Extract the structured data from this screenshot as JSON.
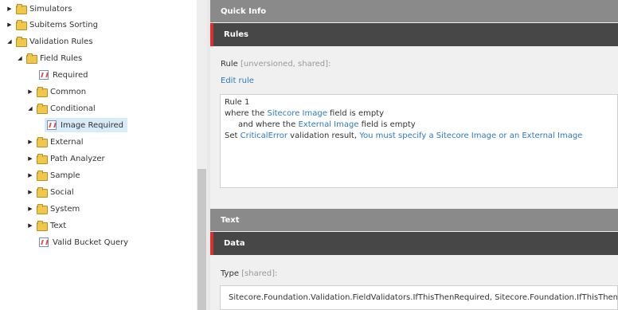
{
  "tree": {
    "items": [
      {
        "label": "Simulators",
        "type": "folder",
        "arrow": "collapsed"
      },
      {
        "label": "Subitems Sorting",
        "type": "folder",
        "arrow": "collapsed"
      },
      {
        "label": "Validation Rules",
        "type": "folder",
        "arrow": "expanded"
      },
      {
        "label": "Field Rules",
        "type": "folder",
        "arrow": "expanded"
      },
      {
        "label": "Required",
        "type": "item",
        "arrow": "none"
      },
      {
        "label": "Common",
        "type": "folder",
        "arrow": "collapsed"
      },
      {
        "label": "Conditional",
        "type": "folder",
        "arrow": "expanded"
      },
      {
        "label": "Image Required",
        "type": "item",
        "arrow": "none",
        "selected": true
      },
      {
        "label": "External",
        "type": "folder",
        "arrow": "collapsed"
      },
      {
        "label": "Path Analyzer",
        "type": "folder",
        "arrow": "collapsed"
      },
      {
        "label": "Sample",
        "type": "folder",
        "arrow": "collapsed"
      },
      {
        "label": "Social",
        "type": "folder",
        "arrow": "collapsed"
      },
      {
        "label": "System",
        "type": "folder",
        "arrow": "collapsed"
      },
      {
        "label": "Text",
        "type": "folder",
        "arrow": "collapsed"
      },
      {
        "label": "Valid Bucket Query",
        "type": "item",
        "arrow": "none"
      }
    ]
  },
  "sections": {
    "quick_info": "Quick Info",
    "rules": "Rules",
    "text": "Text",
    "data": "Data"
  },
  "rules_field": {
    "label": "Rule",
    "qualifier": "[unversioned, shared]:",
    "edit_link": "Edit rule",
    "rule": {
      "title": "Rule 1",
      "line1_a": "where the ",
      "line1_kw": "Sitecore Image",
      "line1_b": " field is empty",
      "line2_a": "and where the ",
      "line2_kw": "External Image",
      "line2_b": " field is empty",
      "line3_a": "Set ",
      "line3_kw1": "CriticalError",
      "line3_b": " validation result, ",
      "line3_kw2": "You must specify a Sitecore Image or an External Image"
    }
  },
  "type_field": {
    "label": "Type",
    "qualifier": "[shared]:",
    "value": "Sitecore.Foundation.Validation.FieldValidators.IfThisThenRequired, Sitecore.Foundation.IfThisThenValid"
  },
  "colors": {
    "accent_red": "#d9302e",
    "link_blue": "#2b7bc0",
    "header_dark": "#474747",
    "header_light": "#8a8a8a"
  }
}
